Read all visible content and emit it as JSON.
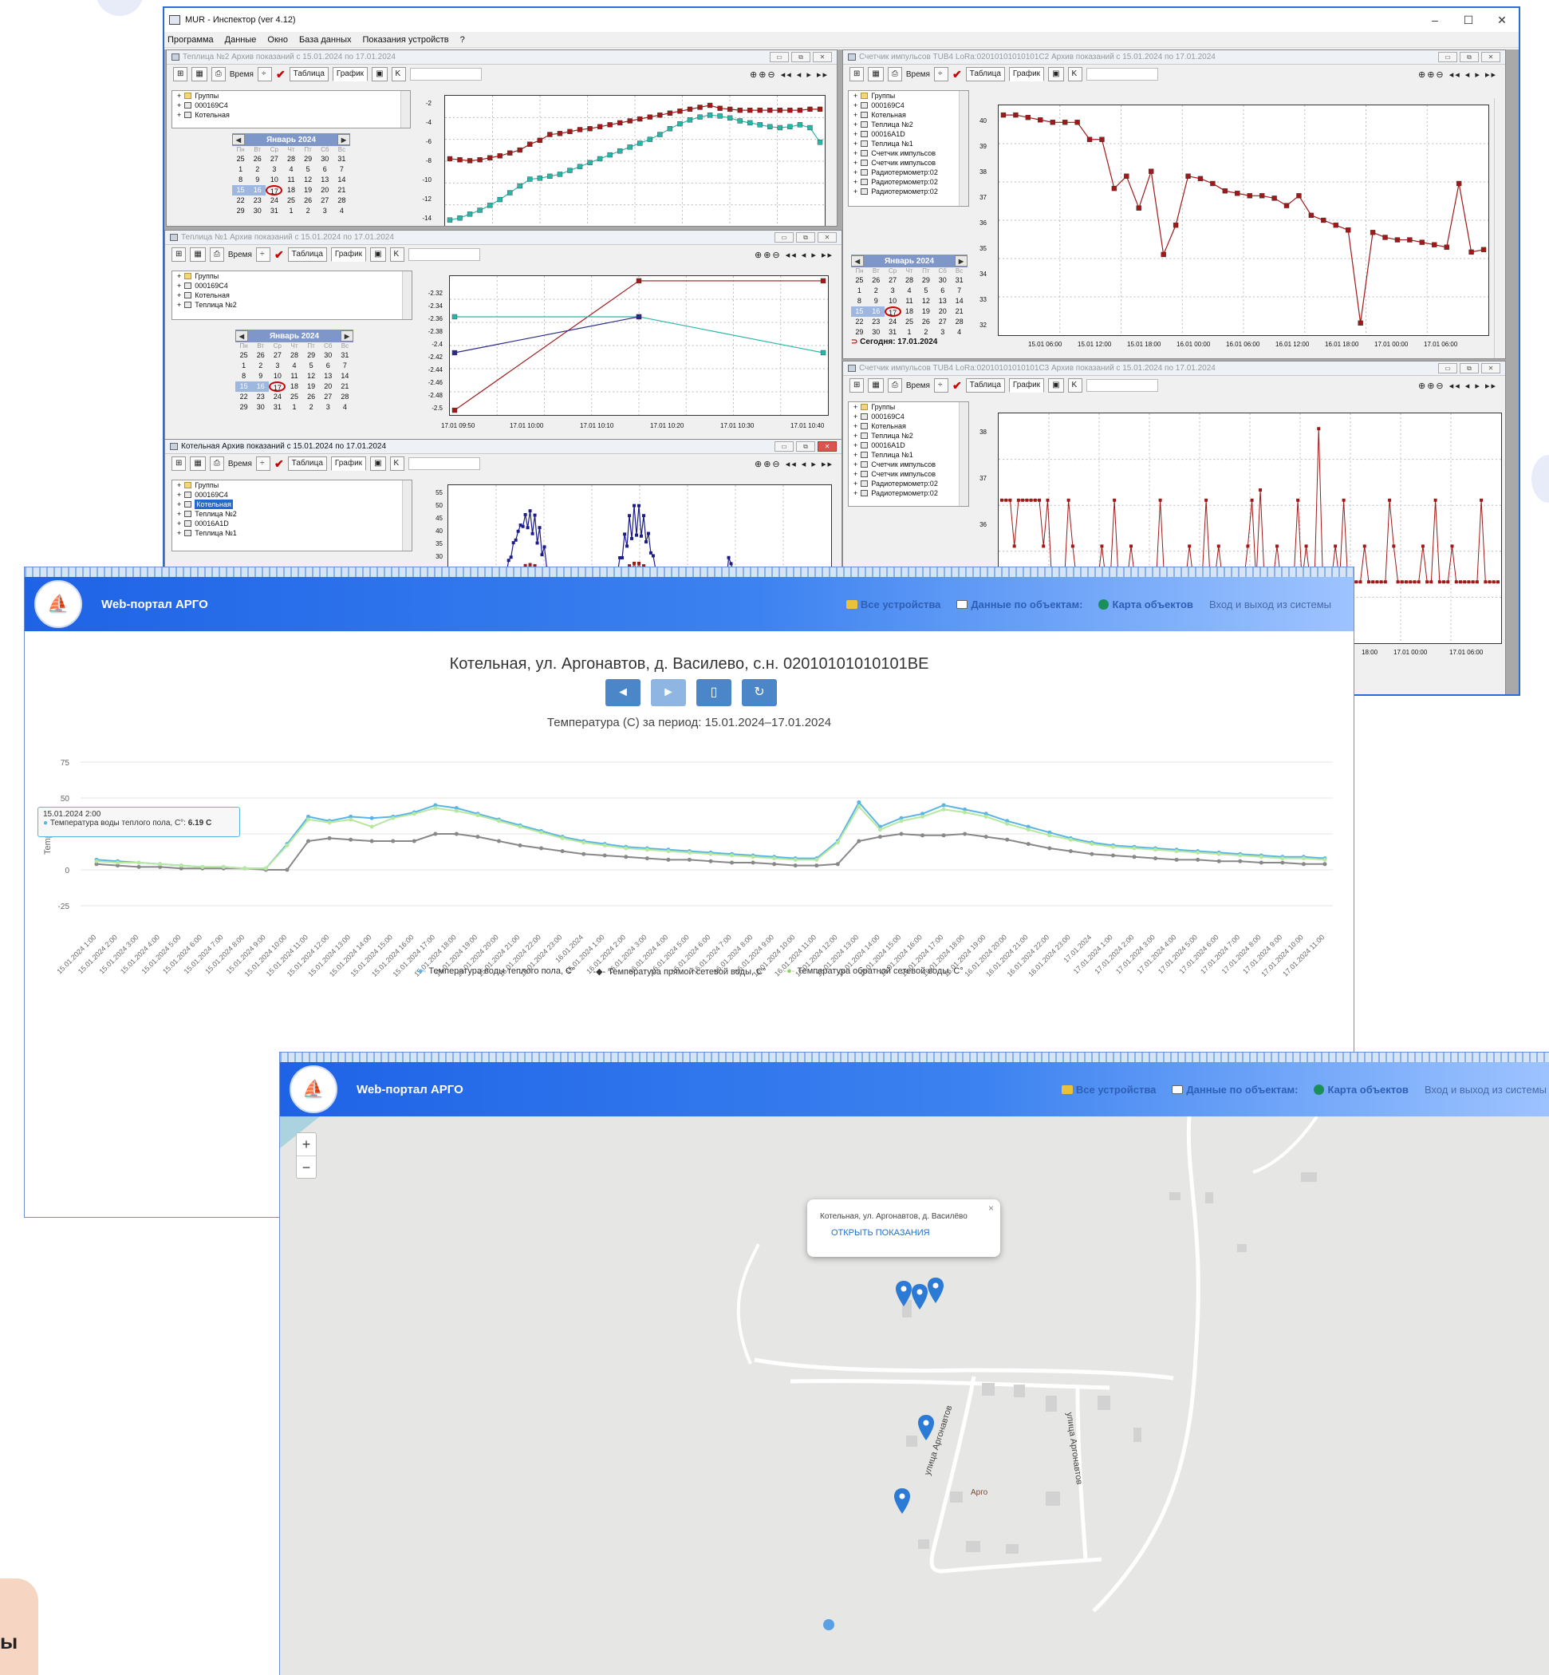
{
  "app": {
    "title": "MUR - Инспектор (ver 4.12)",
    "window_controls": [
      "–",
      "☐",
      "✕"
    ],
    "menu": [
      "Программа",
      "Данные",
      "Окно",
      "База данных",
      "Показания устройств",
      "?"
    ],
    "toolbar": {
      "time_label": "Время",
      "table_tab": "Таблица",
      "graph_tab": "График",
      "k_button": "K",
      "nav": "⊕⊕⊖  ◂◂ ◂ ▸ ▸▸"
    },
    "calendar": {
      "month": "Январь 2024",
      "dow": [
        "Пн",
        "Вт",
        "Ср",
        "Чт",
        "Пт",
        "Сб",
        "Вс"
      ],
      "days": [
        "25",
        "26",
        "27",
        "28",
        "29",
        "30",
        "31",
        "1",
        "2",
        "3",
        "4",
        "5",
        "6",
        "7",
        "8",
        "9",
        "10",
        "11",
        "12",
        "13",
        "14",
        "15",
        "16",
        "17",
        "18",
        "19",
        "20",
        "21",
        "22",
        "23",
        "24",
        "25",
        "26",
        "27",
        "28",
        "29",
        "30",
        "31",
        "1",
        "2",
        "3",
        "4"
      ],
      "today_label": "Сегодня: 17.01.2024"
    },
    "windows": {
      "greenhouse2": {
        "title": "Теплица №2 Архив показаний с 15.01.2024 по 17.01.2024",
        "tree": [
          "Группы",
          "000169C4",
          "Котельная"
        ],
        "yticks": [
          "-2",
          "-4",
          "-6",
          "-8",
          "-10",
          "-12",
          "-14"
        ]
      },
      "greenhouse1": {
        "title": "Теплица №1 Архив показаний с 15.01.2024 по 17.01.2024",
        "tree": [
          "Группы",
          "000169C4",
          "Котельная",
          "Теплица №2"
        ],
        "yticks": [
          "-2.32",
          "-2.34",
          "-2.36",
          "-2.38",
          "-2.4",
          "-2.42",
          "-2.44",
          "-2.46",
          "-2.48",
          "-2.5"
        ],
        "xticks": [
          "17.01 09:50",
          "17.01 10:00",
          "17.01 10:10",
          "17.01 10:20",
          "17.01 10:30",
          "17.01 10:40"
        ]
      },
      "boiler": {
        "title": "Котельная Архив показаний с 15.01.2024 по 17.01.2024",
        "tree": [
          "Группы",
          "000169C4",
          "Котельная",
          "Теплица №2",
          "00016A1D",
          "Теплица №1"
        ],
        "yticks": [
          "55",
          "50",
          "45",
          "40",
          "35",
          "30"
        ]
      },
      "counter2": {
        "title": "Счетчик импульсов TUB4 LoRa:02010101010101C2 Архив показаний с 15.01.2024 по 17.01.2024",
        "tree": [
          "Группы",
          "000169C4",
          "Котельная",
          "Теплица №2",
          "00016A1D",
          "Теплица №1",
          "Счетчик импульсов",
          "Счетчик импульсов",
          "Радиотермометр:02",
          "Радиотермометр:02",
          "Радиотермометр:02"
        ],
        "yticks": [
          "40",
          "39",
          "38",
          "37",
          "36",
          "35",
          "34",
          "33",
          "32"
        ],
        "xticks": [
          "15.01 06:00",
          "15.01 12:00",
          "15.01 18:00",
          "16.01 00:00",
          "16.01 06:00",
          "16.01 12:00",
          "16.01 18:00",
          "17.01 00:00",
          "17.01 06:00"
        ]
      },
      "counter3": {
        "title": "Счетчик импульсов TUB4 LoRa:02010101010101C3 Архив показаний с 15.01.2024 по 17.01.2024",
        "tree": [
          "Группы",
          "000169C4",
          "Котельная",
          "Теплица №2",
          "00016A1D",
          "Теплица №1",
          "Счетчик импульсов",
          "Счетчик импульсов",
          "Радиотермометр:02",
          "Радиотермометр:02"
        ],
        "yticks": [
          "38",
          "37",
          "36",
          "35"
        ],
        "xticks": [
          "18:00",
          "17.01 00:00",
          "17.01 06:00"
        ]
      }
    }
  },
  "portal": {
    "brand": "Web-портал АРГО",
    "nav": [
      "Все устройства",
      "Данные по объектам:",
      "Карта объектов",
      "Вход и выход из системы"
    ],
    "heading": "Котельная, ул. Аргонавтов, д. Василево, с.н. 02010101010101BE",
    "subheading": "Температура (С) за период: 15.01.2024–17.01.2024",
    "buttons": [
      "◄",
      "►",
      "▯",
      "↻"
    ],
    "tooltip": {
      "time": "15.01.2024 2:00",
      "series": "Температура воды теплого пола, С°:",
      "value": "6.19 C"
    },
    "yaxis_label": "Temp (C)",
    "legend": [
      "Температура воды теплого пола, С°",
      "Температура прямой сетевой воды, С°",
      "Температура обратной сетевой воды, С°"
    ]
  },
  "map": {
    "popup_title": "Котельная, ул. Аргонавтов, д. Василёво",
    "popup_link": "ОТКРЫТЬ ПОКАЗАНИЯ",
    "popup_close": "×",
    "zoom_in": "+",
    "zoom_out": "−",
    "street_1": "улица Аргонавтов",
    "street_2": "улица Аргонавтов",
    "place": "Арго"
  },
  "corner_text": "ы",
  "colors": {
    "accent": "#1e63e6",
    "series_floor": "#5ab4e6",
    "series_supply": "#888888",
    "series_return": "#b6e8a0",
    "dark_red": "#a01818",
    "teal": "#27b7a8"
  },
  "chart_data": [
    {
      "type": "line",
      "title": "Температура (С) за период: 15.01.2024–17.01.2024",
      "ylabel": "Temp (C)",
      "ylim": [
        -25,
        75
      ],
      "yticks": [
        75,
        50,
        25,
        0,
        -25
      ],
      "x": [
        "15.01.2024 1:00",
        "15.01.2024 2:00",
        "15.01.2024 3:00",
        "15.01.2024 4:00",
        "15.01.2024 5:00",
        "15.01.2024 6:00",
        "15.01.2024 7:00",
        "15.01.2024 8:00",
        "15.01.2024 9:00",
        "15.01.2024 10:00",
        "15.01.2024 11:00",
        "15.01.2024 12:00",
        "15.01.2024 13:00",
        "15.01.2024 14:00",
        "15.01.2024 15:00",
        "15.01.2024 16:00",
        "15.01.2024 17:00",
        "15.01.2024 18:00",
        "15.01.2024 19:00",
        "15.01.2024 20:00",
        "15.01.2024 21:00",
        "15.01.2024 22:00",
        "15.01.2024 23:00",
        "16.01.2024",
        "16.01.2024 1:00",
        "16.01.2024 2:00",
        "16.01.2024 3:00",
        "16.01.2024 4:00",
        "16.01.2024 5:00",
        "16.01.2024 6:00",
        "16.01.2024 7:00",
        "16.01.2024 8:00",
        "16.01.2024 9:00",
        "16.01.2024 10:00",
        "16.01.2024 11:00",
        "16.01.2024 12:00",
        "16.01.2024 13:00",
        "16.01.2024 14:00",
        "16.01.2024 15:00",
        "16.01.2024 16:00",
        "16.01.2024 17:00",
        "16.01.2024 18:00",
        "16.01.2024 19:00",
        "16.01.2024 20:00",
        "16.01.2024 21:00",
        "16.01.2024 22:00",
        "16.01.2024 23:00",
        "17.01.2024",
        "17.01.2024 1:00",
        "17.01.2024 2:00",
        "17.01.2024 3:00",
        "17.01.2024 4:00",
        "17.01.2024 5:00",
        "17.01.2024 6:00",
        "17.01.2024 7:00",
        "17.01.2024 8:00",
        "17.01.2024 9:00",
        "17.01.2024 10:00",
        "17.01.2024 11:00"
      ],
      "series": [
        {
          "name": "Температура воды теплого пола, С°",
          "color": "#5ab4e6",
          "values": [
            7,
            6,
            5,
            4,
            3,
            2,
            2,
            1,
            1,
            18,
            37,
            34,
            37,
            36,
            37,
            40,
            45,
            43,
            39,
            35,
            31,
            27,
            23,
            20,
            18,
            16,
            15,
            14,
            13,
            12,
            11,
            10,
            9,
            8,
            8,
            20,
            47,
            30,
            36,
            39,
            45,
            42,
            39,
            34,
            30,
            26,
            22,
            19,
            17,
            16,
            15,
            14,
            13,
            12,
            11,
            10,
            9,
            9,
            8,
            24,
            27
          ]
        },
        {
          "name": "Температура прямой сетевой воды, С°",
          "color": "#888888",
          "values": [
            4,
            3,
            2,
            2,
            1,
            1,
            1,
            1,
            0,
            0,
            20,
            22,
            21,
            20,
            20,
            20,
            25,
            25,
            23,
            20,
            17,
            15,
            13,
            11,
            10,
            9,
            8,
            7,
            7,
            6,
            5,
            5,
            4,
            3,
            3,
            4,
            20,
            23,
            25,
            24,
            24,
            25,
            23,
            21,
            18,
            15,
            13,
            11,
            10,
            9,
            8,
            7,
            7,
            6,
            6,
            5,
            5,
            4,
            4,
            5,
            25
          ]
        },
        {
          "name": "Температура обратной сетевой воды, С°",
          "color": "#b6e8a0",
          "values": [
            6,
            5,
            5,
            4,
            3,
            2,
            2,
            1,
            1,
            17,
            35,
            33,
            35,
            30,
            36,
            39,
            43,
            41,
            38,
            34,
            30,
            26,
            22,
            19,
            17,
            15,
            14,
            13,
            12,
            11,
            10,
            9,
            8,
            7,
            7,
            19,
            44,
            28,
            34,
            37,
            42,
            40,
            37,
            32,
            28,
            24,
            21,
            18,
            16,
            15,
            14,
            13,
            12,
            11,
            10,
            9,
            8,
            8,
            7,
            22,
            26
          ]
        }
      ]
    },
    {
      "type": "line",
      "title": "Теплица №2 Архив показаний с 15.01.2024 по 17.01.2024",
      "ylim": [
        -14,
        -1.5
      ],
      "series": [
        {
          "name": "red",
          "color": "#a01818",
          "values": [
            -7.5,
            -7.6,
            -7.7,
            -7.6,
            -7.4,
            -7.2,
            -6.9,
            -6.6,
            -6.0,
            -5.6,
            -5.0,
            -4.9,
            -4.7,
            -4.5,
            -4.4,
            -4.2,
            -4.0,
            -3.8,
            -3.6,
            -3.4,
            -3.2,
            -3.0,
            -2.8,
            -2.6,
            -2.4,
            -2.2,
            -2.0,
            -2.3,
            -2.4,
            -2.5,
            -2.5,
            -2.5,
            -2.5,
            -2.5,
            -2.5,
            -2.5,
            -2.4,
            -2.4
          ]
        },
        {
          "name": "teal",
          "color": "#27b7a8",
          "values": [
            -13.8,
            -13.6,
            -13.2,
            -12.8,
            -12.3,
            -11.7,
            -11.0,
            -10.3,
            -9.6,
            -9.5,
            -9.3,
            -9.1,
            -8.7,
            -8.3,
            -7.9,
            -7.5,
            -7.1,
            -6.7,
            -6.3,
            -5.9,
            -5.5,
            -5.0,
            -4.4,
            -3.9,
            -3.5,
            -3.2,
            -3.0,
            -3.1,
            -3.3,
            -3.6,
            -3.8,
            -4.0,
            -4.2,
            -4.3,
            -4.2,
            -4.0,
            -4.3,
            -5.8
          ]
        }
      ]
    },
    {
      "type": "line",
      "title": "Счетчик импульсов TUB4 LoRa:02010101010101C2 Архив показаний с 15.01.2024 по 17.01.2024",
      "ylim": [
        31.5,
        40.5
      ],
      "series": [
        {
          "name": "red",
          "color": "#a01818",
          "values": [
            40.3,
            40.3,
            40.2,
            40.1,
            40.0,
            40.0,
            40.0,
            39.3,
            39.3,
            37.3,
            37.8,
            36.5,
            38.0,
            34.6,
            35.8,
            37.8,
            37.7,
            37.5,
            37.2,
            37.1,
            37.0,
            37.0,
            36.9,
            36.6,
            37.0,
            36.2,
            36.0,
            35.8,
            35.6,
            31.8,
            35.5,
            35.3,
            35.2,
            35.2,
            35.1,
            35.0,
            34.9,
            37.5,
            34.7,
            34.8
          ]
        }
      ]
    },
    {
      "type": "line",
      "title": "Теплица №1 Архив показаний с 15.01.2024 по 17.01.2024",
      "x": [
        "17.01 09:50",
        "17.01 10:10",
        "17.01 10:40"
      ],
      "ylim": [
        -2.5,
        -2.32
      ],
      "series": [
        {
          "name": "red",
          "color": "#a01818",
          "values": [
            -2.5,
            -2.32,
            -2.32
          ]
        },
        {
          "name": "teal",
          "color": "#27b7a8",
          "values": [
            -2.37,
            -2.37,
            -2.42
          ]
        },
        {
          "name": "navy",
          "color": "#2a2a8a",
          "values": [
            -2.42,
            -2.37,
            null
          ]
        }
      ]
    }
  ]
}
